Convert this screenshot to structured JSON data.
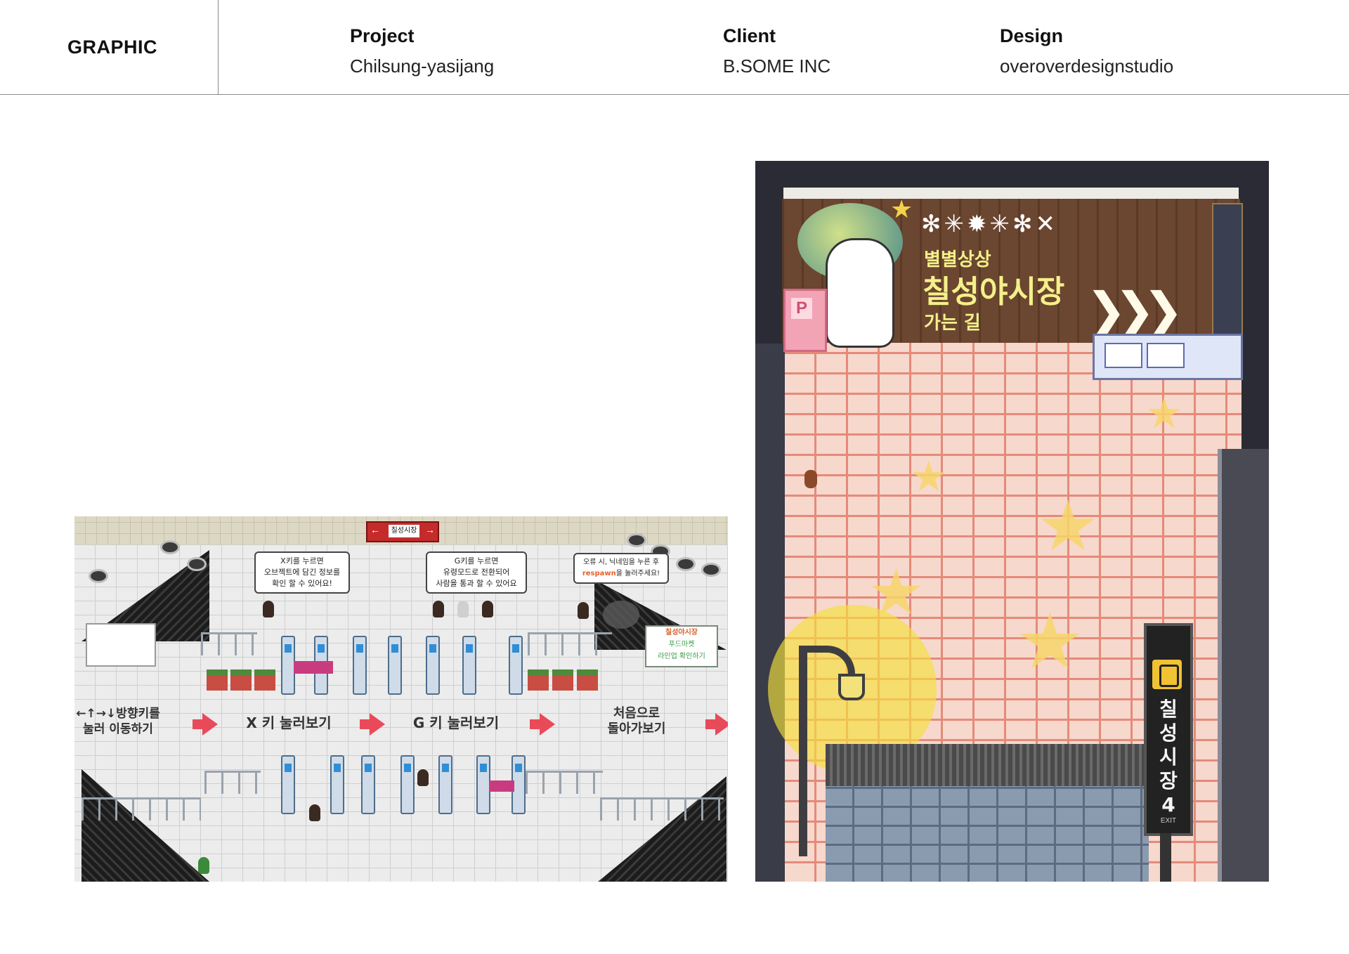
{
  "header": {
    "section": "GRAPHIC",
    "project": {
      "label": "Project",
      "value": "Chilsung-yasijang"
    },
    "client": {
      "label": "Client",
      "value": "B.SOME INC"
    },
    "design": {
      "label": "Design",
      "value": "overoverdesignstudio"
    }
  },
  "left_image": {
    "top_sign": "칠성시장",
    "bubble_x": [
      "X키를 누르면",
      "오브젝트에 담긴 정보를",
      "확인 할 수 있어요!"
    ],
    "bubble_g": [
      "G키를 누르면",
      "유령모드로 전환되어",
      "사람을 통과 할 수 있어요"
    ],
    "bubble_err": {
      "line1": "오류 시, 닉네임을 누른 후",
      "word": "respawn",
      "tail": "을 눌러주세요!"
    },
    "board": [
      "칠성야시장",
      "푸드마켓",
      "라인업 확인하기"
    ],
    "steps": {
      "move": [
        "←↑→↓방향키를",
        "눌러 이동하기"
      ],
      "x": "X 키 눌러보기",
      "g": "G 키 눌러보기",
      "back": [
        "처음으로",
        "돌아가보기"
      ]
    }
  },
  "right_image": {
    "banner_small": "별별상상",
    "banner_main": "칠성야시장",
    "banner_sub": "가는 길",
    "parking": "P",
    "exit_sign": [
      "칠",
      "성",
      "시",
      "장",
      "4"
    ],
    "exit_word": "EXIT"
  }
}
